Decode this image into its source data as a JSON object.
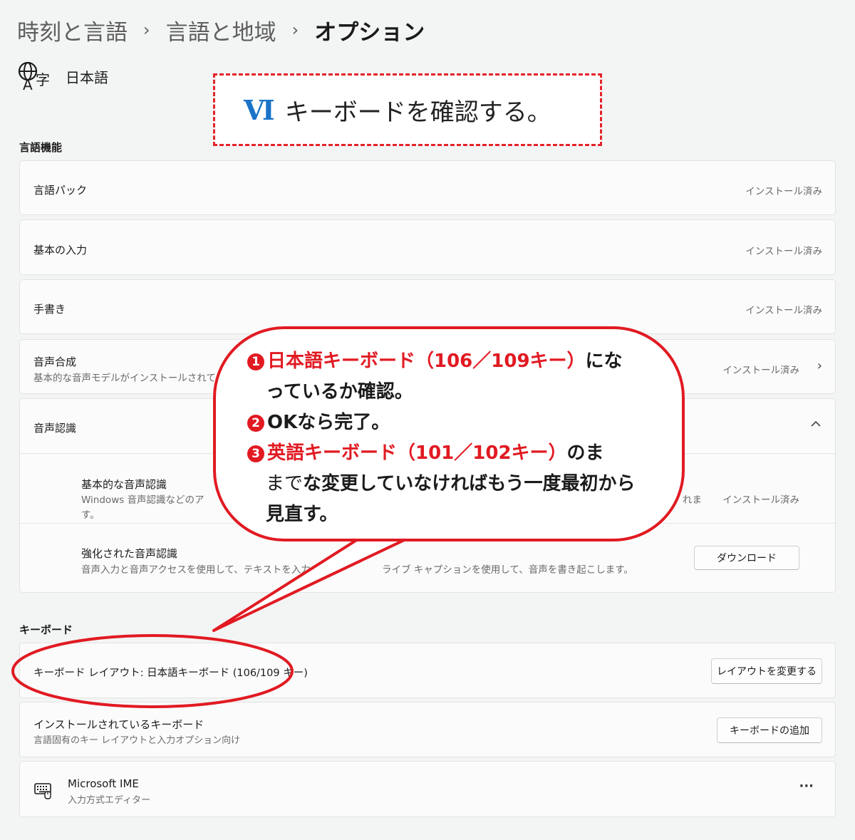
{
  "breadcrumb": {
    "item1": "時刻と言語",
    "item2": "言語と地域",
    "item3": "オプション"
  },
  "language": {
    "name": "日本語"
  },
  "title_box": {
    "number": "Ⅵ",
    "text": "キーボードを確認する。"
  },
  "sections": {
    "language_features": "言語機能",
    "keyboard": "キーボード"
  },
  "features": {
    "language_pack": {
      "title": "言語パック",
      "status": "インストール済み"
    },
    "basic_input": {
      "title": "基本の入力",
      "status": "インストール済み"
    },
    "handwriting": {
      "title": "手書き",
      "status": "インストール済み"
    },
    "speech_synthesis": {
      "title": "音声合成",
      "sub": "基本的な音声モデルがインストールされて",
      "status": "インストール済み"
    },
    "speech_recognition": {
      "title": "音声認識",
      "basic": {
        "title": "基本的な音声認識",
        "sub1": "Windows 音声認識などのア",
        "sub1_end": "れま",
        "sub2": "す。",
        "status": "インストール済み"
      },
      "enhanced": {
        "title": "強化された音声認識",
        "sub_a": "音声入力と音声アクセスを使用して、テキストを入力",
        "sub_b": "ライブ キャプションを使用して、音声を書き起こします。",
        "button": "ダウンロード"
      }
    }
  },
  "keyboard": {
    "layout": {
      "label": "キーボード レイアウト: 日本語キーボード (106/109 キー)",
      "button": "レイアウトを変更する"
    },
    "installed": {
      "title": "インストールされているキーボード",
      "sub": "言語固有のキー レイアウトと入力オプション向け",
      "button": "キーボードの追加"
    },
    "ime": {
      "title": "Microsoft IME",
      "sub": "入力方式エディター",
      "more": "···"
    }
  },
  "bubble": {
    "n1": "1",
    "line1_red": "日本語キーボード（106／109キー）",
    "line1_black": "にな",
    "line2": "っているか確認。",
    "n2": "2",
    "line3": "OKなら完了。",
    "n3": "3",
    "line4_red": "英語キーボード（101／102キー）",
    "line4_black": "のま",
    "line5_a": "まで",
    "line5_b": "な変更していなければもう一度最初から",
    "line6": "見直す。"
  },
  "colors": {
    "accent_red": "#e11a22",
    "title_blue": "#1a73c7"
  }
}
